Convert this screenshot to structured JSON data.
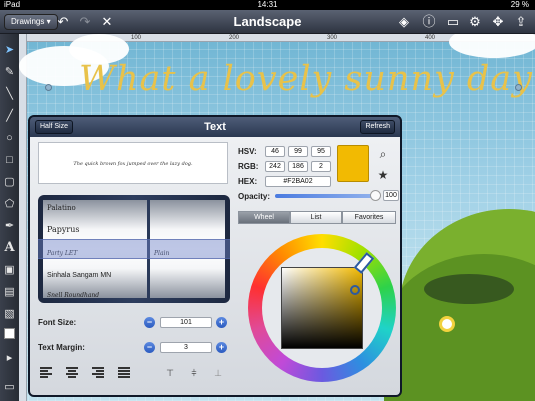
{
  "status": {
    "device": "iPad",
    "time": "14:31",
    "battery": "29 %"
  },
  "toolbar": {
    "drawings_label": "Drawings ▾",
    "title": "Landscape",
    "icons": [
      "undo-icon",
      "redo-icon",
      "close-icon",
      "layers-icon",
      "info-icon",
      "display-icon",
      "gear-icon",
      "move-icon",
      "share-icon"
    ]
  },
  "tools": [
    "select-icon",
    "pencil-icon",
    "pen-icon",
    "line-icon",
    "circle-icon",
    "square-icon",
    "rounded-rect-icon",
    "polygon-icon",
    "fountain-pen-icon",
    "text-icon",
    "image-icon",
    "screen-icon",
    "stroke-color-icon",
    "fill-color-icon",
    "right-arrow-icon",
    "comment-icon"
  ],
  "canvas": {
    "headline": "What a lovely sunny day",
    "ruler_marks": [
      "100",
      "200",
      "300",
      "400"
    ]
  },
  "text_panel": {
    "title": "Text",
    "half_size_label": "Half Size",
    "refresh_label": "Refresh",
    "preview_text": "The quick brown fox jumped over the lazy dog.",
    "fonts": [
      "Palatino",
      "Papyrus",
      "Party LET",
      "Sinhala Sangam MN",
      "Snell Roundhand"
    ],
    "styles": [
      "Plain"
    ],
    "font_size_label": "Font Size:",
    "font_size": "101",
    "text_margin_label": "Text Margin:",
    "text_margin": "3",
    "hsv_label": "HSV:",
    "hsv": [
      "46",
      "99",
      "95"
    ],
    "rgb_label": "RGB:",
    "rgb": [
      "242",
      "186",
      "2"
    ],
    "hex_label": "HEX:",
    "hex": "#F2BA02",
    "opacity_label": "Opacity:",
    "opacity": "100",
    "tabs": [
      "Wheel",
      "List",
      "Favorites"
    ],
    "active_tab": "Wheel",
    "color": "#F2BA02"
  }
}
